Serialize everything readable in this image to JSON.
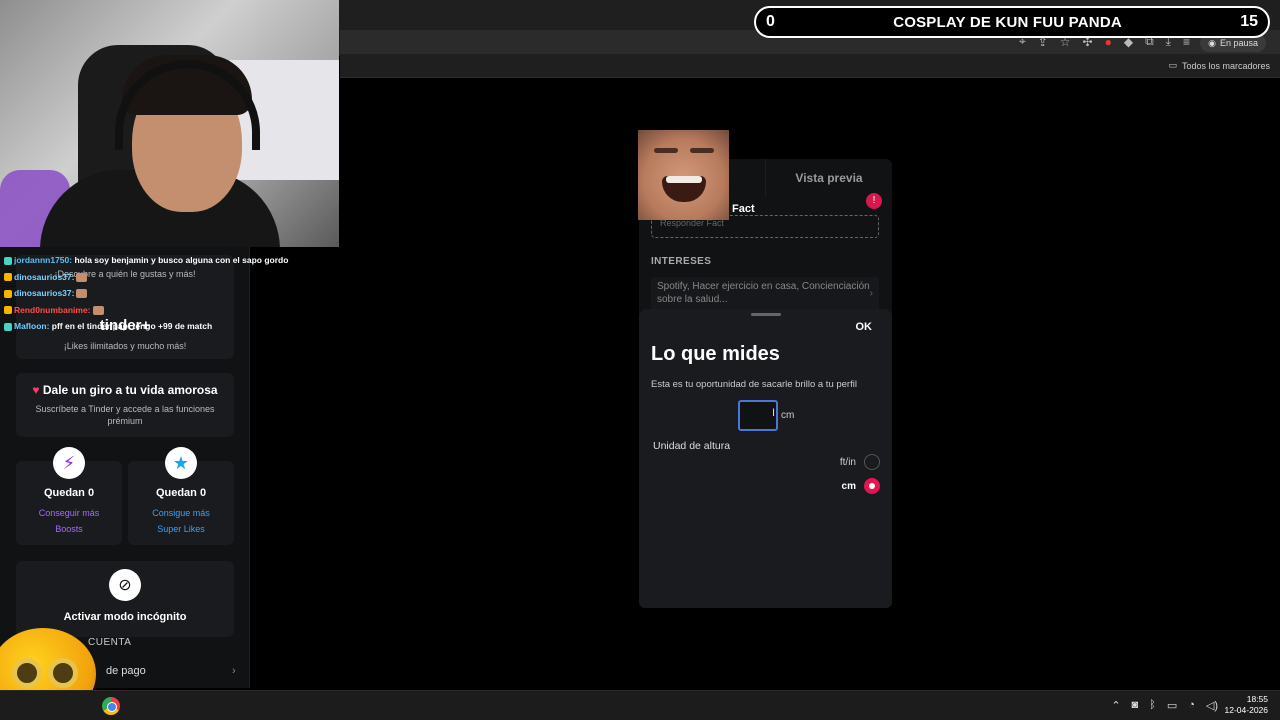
{
  "stream": {
    "score_left": "0",
    "title": "COSPLAY DE KUN FUU PANDA",
    "score_right": "15"
  },
  "browser": {
    "paused_label": "En pausa",
    "bookmarks_all": "Todos los marcadores"
  },
  "chat": [
    {
      "user": "jordannn1750:",
      "message": " hola soy benjamin y busco alguna con el sapo gordo",
      "color": "#4fc3f7",
      "emote": false
    },
    {
      "user": "dinosaurios37:",
      "message": "",
      "color": "#7bd3ff",
      "emote": true
    },
    {
      "user": "dinosaurios37:",
      "message": "",
      "color": "#7bd3ff",
      "emote": true
    },
    {
      "user": "Rend0numbanime:",
      "message": "",
      "color": "#ff4d4d",
      "emote": true
    },
    {
      "user": "Mafloon:",
      "message": " pff en el tinder papi tengo +99 de match",
      "color": "#6ad1ff",
      "emote": false
    }
  ],
  "sidebar": {
    "gold_sub": "¡Descubre a quién le gustas y más!",
    "plus_logo": "tinder+",
    "plus_sub": "¡Likes ilimitados y mucho más!",
    "promo_title": "Dale un giro a tu vida amorosa",
    "promo_sub": "Suscríbete a Tinder y accede a las funciones prémium",
    "boosts": {
      "count": "Quedan 0",
      "link1": "Conseguir más",
      "link2": "Boosts"
    },
    "superlikes": {
      "count": "Quedan 0",
      "link1": "Consigue más",
      "link2": "Super Likes"
    },
    "incognito": "Activar modo incógnito",
    "account": "CUENTA",
    "payment": "de pago"
  },
  "panel": {
    "tab_preview": "Vista previa",
    "fact_label": "Fact",
    "fact_placeholder": "Responder Fact",
    "interests_label": "INTERESES",
    "interests_value": "Spotify, Hacer ejercicio en casa, Concienciación sobre la salud..."
  },
  "sheet": {
    "ok": "OK",
    "title": "Lo que mides",
    "subtitle": "Esta es tu oportunidad de sacarle brillo a tu perfil",
    "unit_suffix": "cm",
    "unit_heading": "Unidad de altura",
    "option_ftin": "ft/in",
    "option_cm": "cm",
    "selected_unit": "cm"
  },
  "taskbar": {
    "time": "18:55",
    "date": "12-04-2026"
  },
  "colors": {
    "accent": "#e5154f",
    "input_focus": "#4a76d8"
  }
}
